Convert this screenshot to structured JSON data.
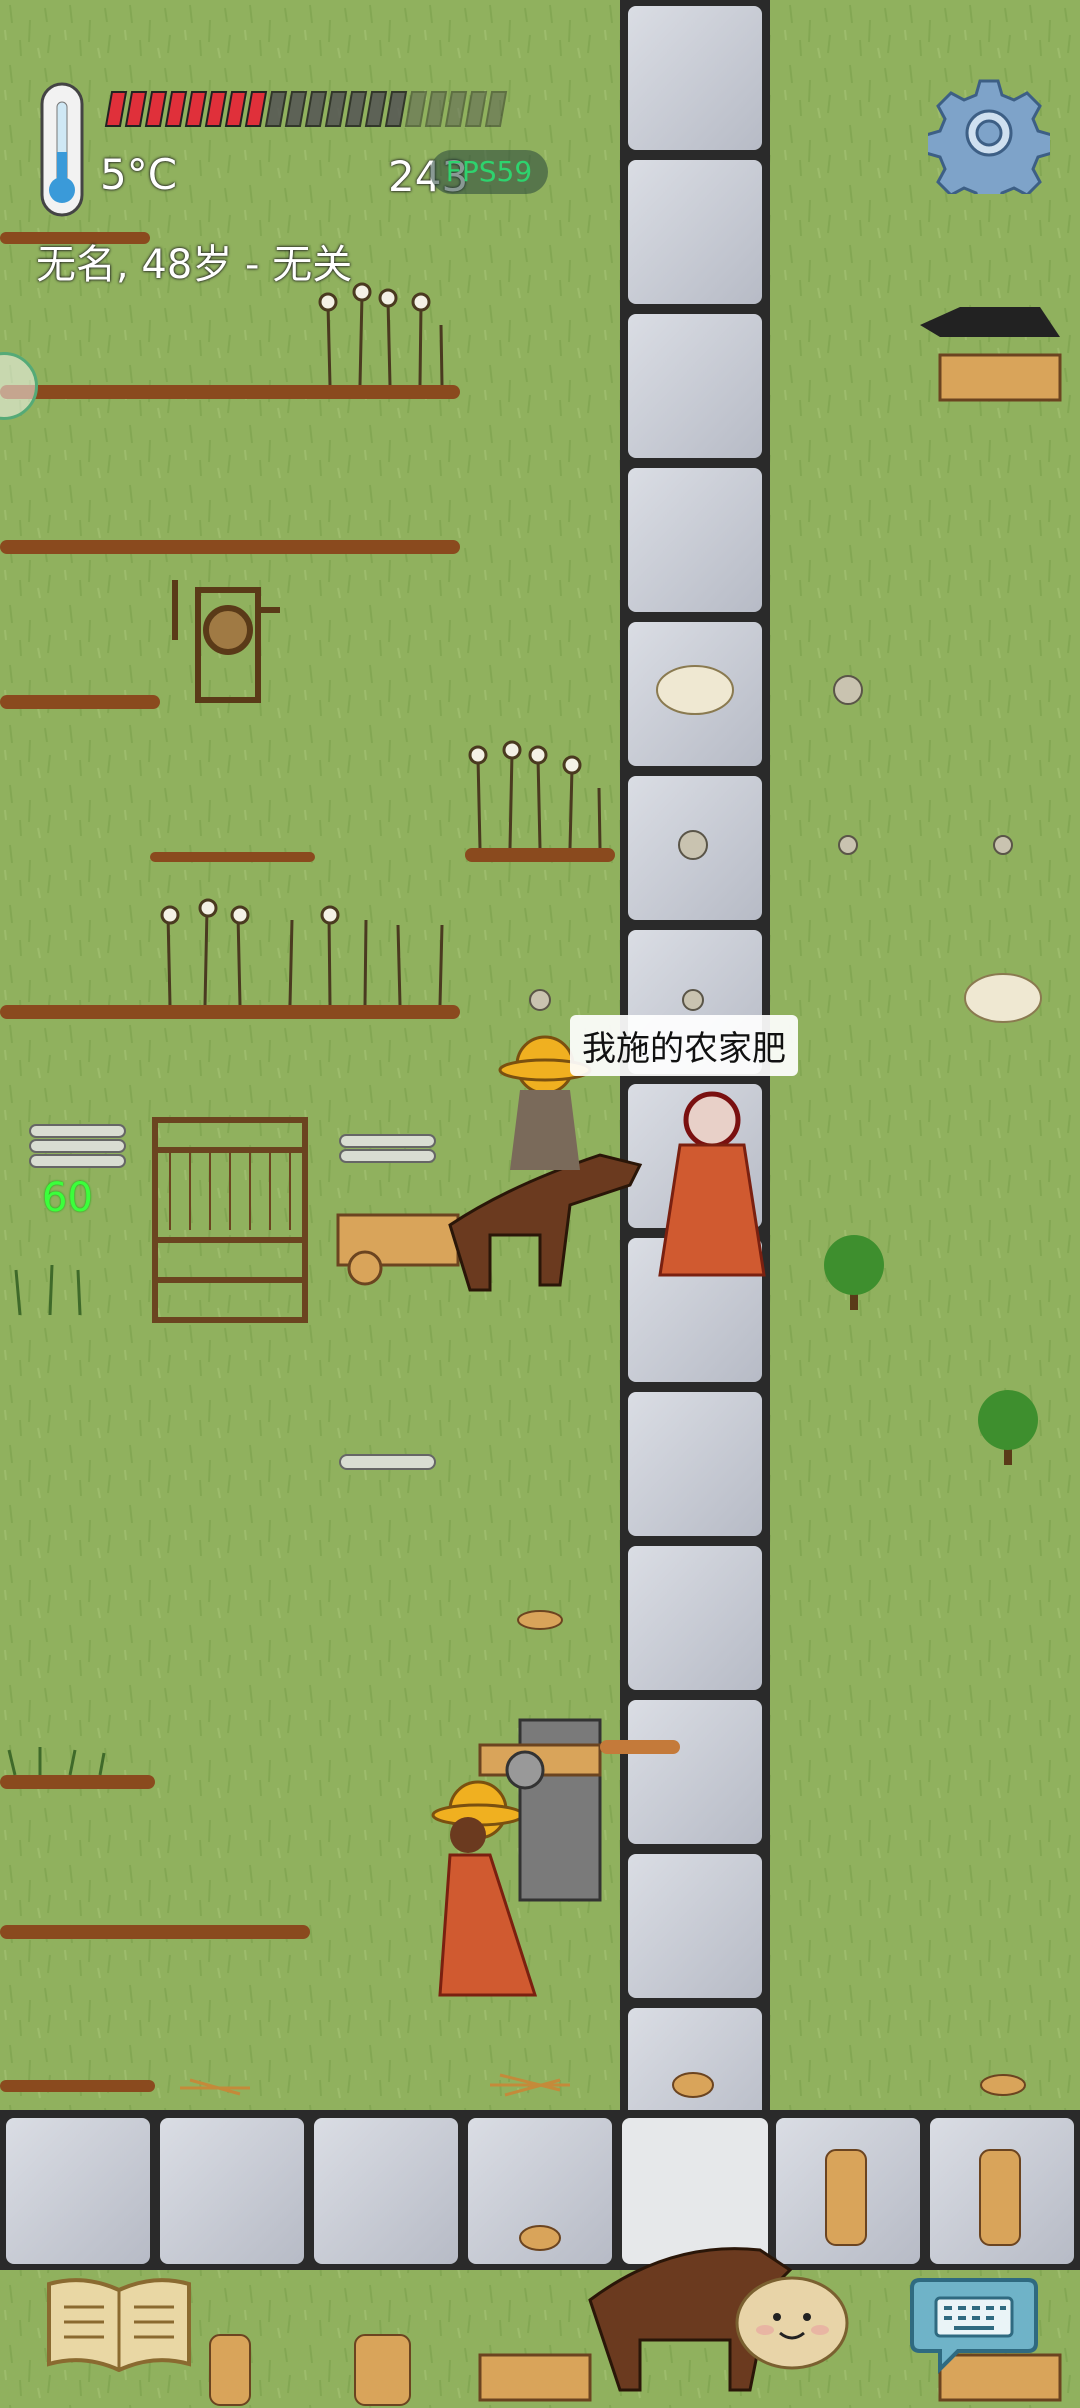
{
  "hud": {
    "temperature": "5°C",
    "identity": "无名, 48岁 - 无关",
    "counter": "243",
    "fps": "FPS59",
    "food_meter_filled": 0.42
  },
  "chat": {
    "speech_bubble": "我施的农家肥"
  },
  "world": {
    "hunger_tick": "60"
  },
  "icons": {
    "settings": "gear-icon",
    "thermometer": "thermometer-icon",
    "recipe_book": "book-icon",
    "keyboard": "keyboard-icon",
    "emote": "emote-face-icon"
  },
  "colors": {
    "grass": "#8fb060",
    "stone": "#c9ccd4",
    "food_red": "#e0303a",
    "fps_green": "#2ed36e",
    "hunger_green": "#3bff3b"
  }
}
